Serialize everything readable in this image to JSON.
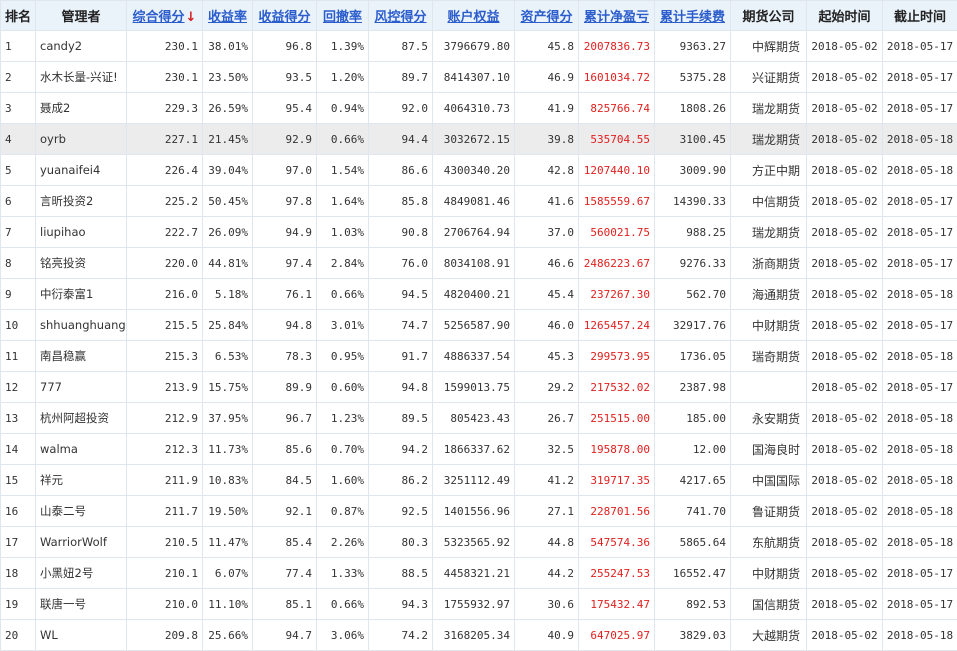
{
  "headers": [
    "排名",
    "管理者",
    "综合得分",
    "收益率",
    "收益得分",
    "回撤率",
    "风控得分",
    "账户权益",
    "资产得分",
    "累计净盈亏",
    "累计手续费",
    "期货公司",
    "起始时间",
    "截止时间"
  ],
  "sort_arrow": "↓",
  "rows": [
    {
      "rank": "1",
      "name": "candy2",
      "score": "230.1",
      "ret": "38.01%",
      "ret_score": "96.8",
      "dd": "1.39%",
      "risk": "87.5",
      "equity": "3796679.80",
      "asset": "45.8",
      "pnl": "2007836.73",
      "fee": "9363.27",
      "company": "中辉期货",
      "start": "2018-05-02",
      "end": "2018-05-17"
    },
    {
      "rank": "2",
      "name": "水木长量-兴证!",
      "score": "230.1",
      "ret": "23.50%",
      "ret_score": "93.5",
      "dd": "1.20%",
      "risk": "89.7",
      "equity": "8414307.10",
      "asset": "46.9",
      "pnl": "1601034.72",
      "fee": "5375.28",
      "company": "兴证期货",
      "start": "2018-05-02",
      "end": "2018-05-17"
    },
    {
      "rank": "3",
      "name": "聂成2",
      "score": "229.3",
      "ret": "26.59%",
      "ret_score": "95.4",
      "dd": "0.94%",
      "risk": "92.0",
      "equity": "4064310.73",
      "asset": "41.9",
      "pnl": "825766.74",
      "fee": "1808.26",
      "company": "瑞龙期货",
      "start": "2018-05-02",
      "end": "2018-05-17"
    },
    {
      "rank": "4",
      "name": "oyrb",
      "score": "227.1",
      "ret": "21.45%",
      "ret_score": "92.9",
      "dd": "0.66%",
      "risk": "94.4",
      "equity": "3032672.15",
      "asset": "39.8",
      "pnl": "535704.55",
      "fee": "3100.45",
      "company": "瑞龙期货",
      "start": "2018-05-02",
      "end": "2018-05-18",
      "highlight": true
    },
    {
      "rank": "5",
      "name": "yuanaifei4",
      "score": "226.4",
      "ret": "39.04%",
      "ret_score": "97.0",
      "dd": "1.54%",
      "risk": "86.6",
      "equity": "4300340.20",
      "asset": "42.8",
      "pnl": "1207440.10",
      "fee": "3009.90",
      "company": "方正中期",
      "start": "2018-05-02",
      "end": "2018-05-18"
    },
    {
      "rank": "6",
      "name": "言昕投资2",
      "score": "225.2",
      "ret": "50.45%",
      "ret_score": "97.8",
      "dd": "1.64%",
      "risk": "85.8",
      "equity": "4849081.46",
      "asset": "41.6",
      "pnl": "1585559.67",
      "fee": "14390.33",
      "company": "中信期货",
      "start": "2018-05-02",
      "end": "2018-05-17"
    },
    {
      "rank": "7",
      "name": "liupihao",
      "score": "222.7",
      "ret": "26.09%",
      "ret_score": "94.9",
      "dd": "1.03%",
      "risk": "90.8",
      "equity": "2706764.94",
      "asset": "37.0",
      "pnl": "560021.75",
      "fee": "988.25",
      "company": "瑞龙期货",
      "start": "2018-05-02",
      "end": "2018-05-17"
    },
    {
      "rank": "8",
      "name": "铭亮投资",
      "score": "220.0",
      "ret": "44.81%",
      "ret_score": "97.4",
      "dd": "2.84%",
      "risk": "76.0",
      "equity": "8034108.91",
      "asset": "46.6",
      "pnl": "2486223.67",
      "fee": "9276.33",
      "company": "浙商期货",
      "start": "2018-05-02",
      "end": "2018-05-17"
    },
    {
      "rank": "9",
      "name": "中衍泰富1",
      "score": "216.0",
      "ret": "5.18%",
      "ret_score": "76.1",
      "dd": "0.66%",
      "risk": "94.5",
      "equity": "4820400.21",
      "asset": "45.4",
      "pnl": "237267.30",
      "fee": "562.70",
      "company": "海通期货",
      "start": "2018-05-02",
      "end": "2018-05-18"
    },
    {
      "rank": "10",
      "name": "shhuanghuang",
      "score": "215.5",
      "ret": "25.84%",
      "ret_score": "94.8",
      "dd": "3.01%",
      "risk": "74.7",
      "equity": "5256587.90",
      "asset": "46.0",
      "pnl": "1265457.24",
      "fee": "32917.76",
      "company": "中财期货",
      "start": "2018-05-02",
      "end": "2018-05-17"
    },
    {
      "rank": "11",
      "name": "南昌稳赢",
      "score": "215.3",
      "ret": "6.53%",
      "ret_score": "78.3",
      "dd": "0.95%",
      "risk": "91.7",
      "equity": "4886337.54",
      "asset": "45.3",
      "pnl": "299573.95",
      "fee": "1736.05",
      "company": "瑞奇期货",
      "start": "2018-05-02",
      "end": "2018-05-18"
    },
    {
      "rank": "12",
      "name": "777",
      "score": "213.9",
      "ret": "15.75%",
      "ret_score": "89.9",
      "dd": "0.60%",
      "risk": "94.8",
      "equity": "1599013.75",
      "asset": "29.2",
      "pnl": "217532.02",
      "fee": "2387.98",
      "company": "",
      "start": "2018-05-02",
      "end": "2018-05-17"
    },
    {
      "rank": "13",
      "name": "杭州阿超投资",
      "score": "212.9",
      "ret": "37.95%",
      "ret_score": "96.7",
      "dd": "1.23%",
      "risk": "89.5",
      "equity": "805423.43",
      "asset": "26.7",
      "pnl": "251515.00",
      "fee": "185.00",
      "company": "永安期货",
      "start": "2018-05-02",
      "end": "2018-05-18"
    },
    {
      "rank": "14",
      "name": "walma",
      "score": "212.3",
      "ret": "11.73%",
      "ret_score": "85.6",
      "dd": "0.70%",
      "risk": "94.2",
      "equity": "1866337.62",
      "asset": "32.5",
      "pnl": "195878.00",
      "fee": "12.00",
      "company": "国海良时",
      "start": "2018-05-02",
      "end": "2018-05-18"
    },
    {
      "rank": "15",
      "name": "祥元",
      "score": "211.9",
      "ret": "10.83%",
      "ret_score": "84.5",
      "dd": "1.60%",
      "risk": "86.2",
      "equity": "3251112.49",
      "asset": "41.2",
      "pnl": "319717.35",
      "fee": "4217.65",
      "company": "中国国际",
      "start": "2018-05-02",
      "end": "2018-05-18"
    },
    {
      "rank": "16",
      "name": "山泰二号",
      "score": "211.7",
      "ret": "19.50%",
      "ret_score": "92.1",
      "dd": "0.87%",
      "risk": "92.5",
      "equity": "1401556.96",
      "asset": "27.1",
      "pnl": "228701.56",
      "fee": "741.70",
      "company": "鲁证期货",
      "start": "2018-05-02",
      "end": "2018-05-18"
    },
    {
      "rank": "17",
      "name": "WarriorWolf",
      "score": "210.5",
      "ret": "11.47%",
      "ret_score": "85.4",
      "dd": "2.26%",
      "risk": "80.3",
      "equity": "5323565.92",
      "asset": "44.8",
      "pnl": "547574.36",
      "fee": "5865.64",
      "company": "东航期货",
      "start": "2018-05-02",
      "end": "2018-05-18"
    },
    {
      "rank": "18",
      "name": "小黑妞2号",
      "score": "210.1",
      "ret": "6.07%",
      "ret_score": "77.4",
      "dd": "1.33%",
      "risk": "88.5",
      "equity": "4458321.21",
      "asset": "44.2",
      "pnl": "255247.53",
      "fee": "16552.47",
      "company": "中财期货",
      "start": "2018-05-02",
      "end": "2018-05-17"
    },
    {
      "rank": "19",
      "name": "联唐一号",
      "score": "210.0",
      "ret": "11.10%",
      "ret_score": "85.1",
      "dd": "0.66%",
      "risk": "94.3",
      "equity": "1755932.97",
      "asset": "30.6",
      "pnl": "175432.47",
      "fee": "892.53",
      "company": "国信期货",
      "start": "2018-05-02",
      "end": "2018-05-17"
    },
    {
      "rank": "20",
      "name": "WL",
      "score": "209.8",
      "ret": "25.66%",
      "ret_score": "94.7",
      "dd": "3.06%",
      "risk": "74.2",
      "equity": "3168205.34",
      "asset": "40.9",
      "pnl": "647025.97",
      "fee": "3829.03",
      "company": "大越期货",
      "start": "2018-05-02",
      "end": "2018-05-18"
    }
  ]
}
